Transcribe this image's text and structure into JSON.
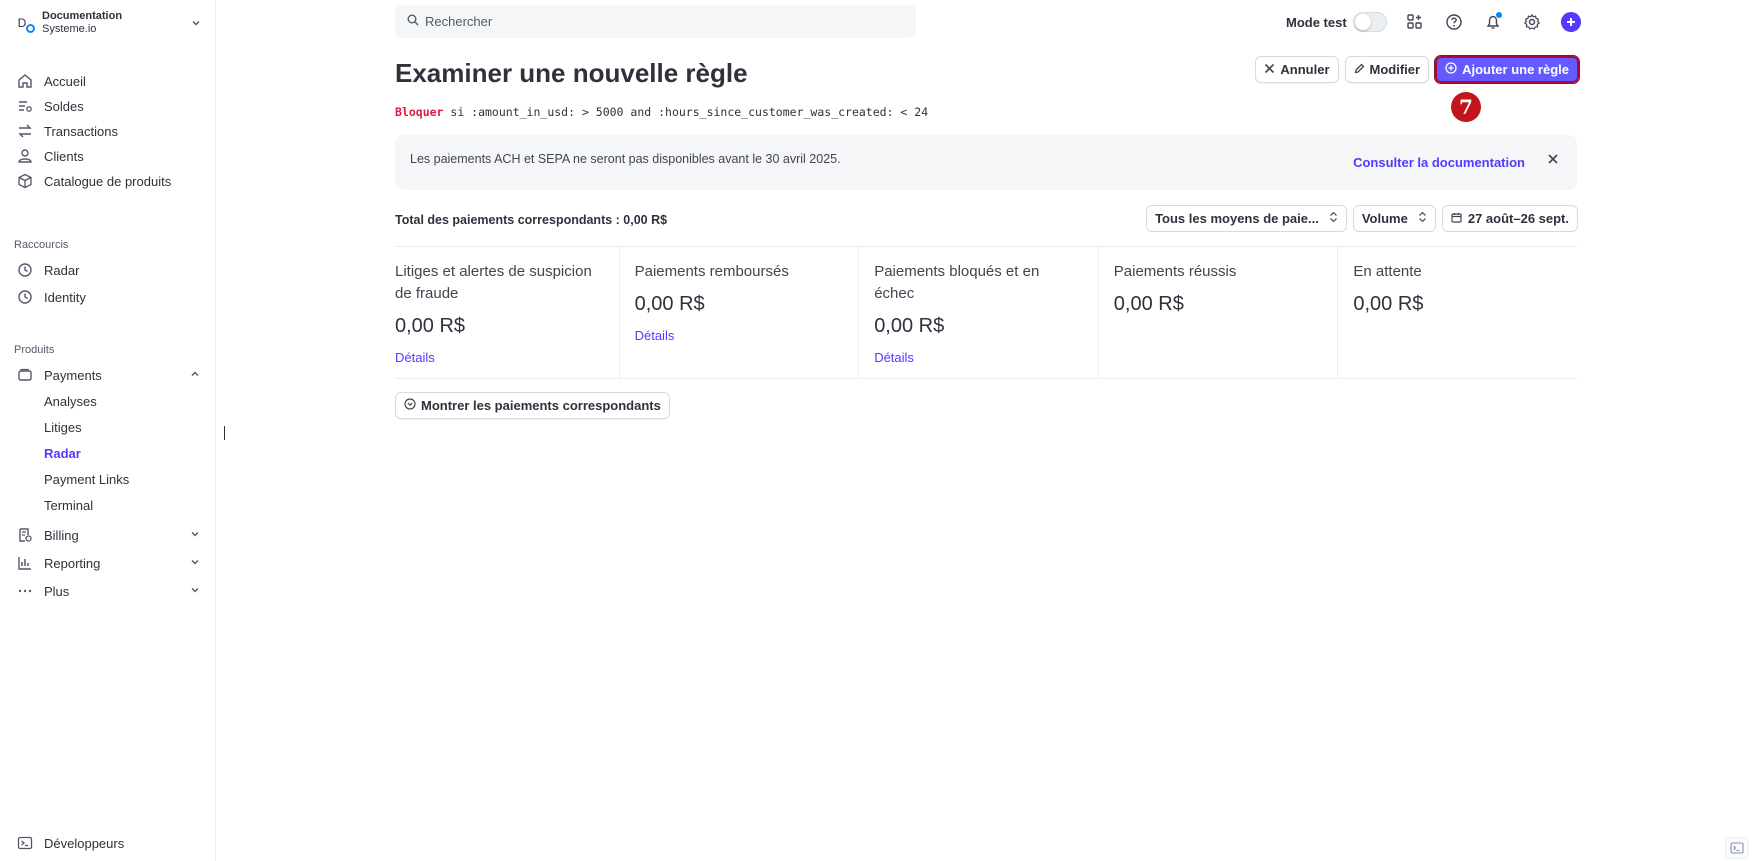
{
  "account": {
    "avatar_letter": "D",
    "name": "Documentation",
    "sub": "Systeme.io"
  },
  "sidebar": {
    "main_items": [
      {
        "label": "Accueil",
        "icon": "home-icon"
      },
      {
        "label": "Soldes",
        "icon": "balance-icon"
      },
      {
        "label": "Transactions",
        "icon": "arrows-icon"
      },
      {
        "label": "Clients",
        "icon": "person-icon"
      },
      {
        "label": "Catalogue de produits",
        "icon": "box-icon"
      }
    ],
    "shortcuts_label": "Raccourcis",
    "shortcuts": [
      {
        "label": "Radar",
        "icon": "clock-icon"
      },
      {
        "label": "Identity",
        "icon": "clock-icon"
      }
    ],
    "products_label": "Produits",
    "payments": {
      "label": "Payments",
      "sub_items": [
        "Analyses",
        "Litiges",
        "Radar",
        "Payment Links",
        "Terminal"
      ],
      "active": "Radar"
    },
    "billing": "Billing",
    "reporting": "Reporting",
    "plus": "Plus",
    "developers": "Développeurs"
  },
  "search": {
    "placeholder": "Rechercher"
  },
  "topbar": {
    "mode_test": "Mode test"
  },
  "header": {
    "title": "Examiner une nouvelle règle",
    "rule_keyword": "Bloquer",
    "rule_text": " si :amount_in_usd: > 5000 and :hours_since_customer_was_created: < 24",
    "cancel": "Annuler",
    "edit": "Modifier",
    "add_rule": "Ajouter une règle",
    "step_badge": "7"
  },
  "banner": {
    "text": "Les paiements ACH et SEPA ne seront pas disponibles avant le 30 avril 2025.",
    "link": "Consulter la documentation"
  },
  "filters": {
    "total": "Total des paiements correspondants : 0,00 R$",
    "methods": "Tous les moyens de paie...",
    "volume": "Volume",
    "date": "27 août–26 sept."
  },
  "stats": [
    {
      "label": "Litiges et alertes de suspicion de fraude",
      "value": "0,00 R$",
      "link": "Détails"
    },
    {
      "label": "Paiements remboursés",
      "value": "0,00 R$",
      "link": "Détails"
    },
    {
      "label": "Paiements bloqués et en échec",
      "value": "0,00 R$",
      "link": "Détails"
    },
    {
      "label": "Paiements réussis",
      "value": "0,00 R$",
      "link": ""
    },
    {
      "label": "En attente",
      "value": "0,00 R$",
      "link": ""
    }
  ],
  "show_payments": "Montrer les paiements correspondants"
}
